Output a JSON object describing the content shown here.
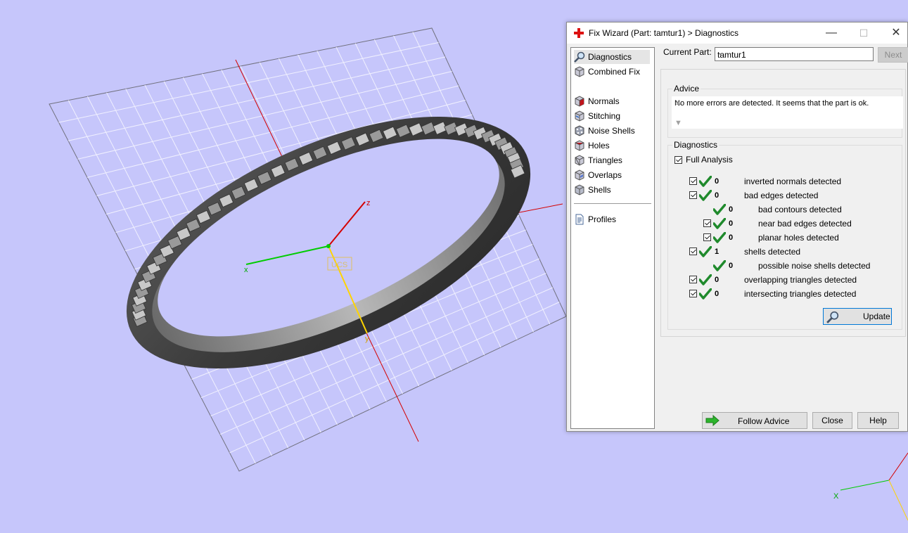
{
  "window": {
    "title": "Fix Wizard (Part: tamtur1) > Diagnostics",
    "minimize": "—",
    "maximize": "☐",
    "close": "✕"
  },
  "nav": {
    "items": [
      {
        "label": "Diagnostics",
        "icon": "magnifier-icon",
        "selected": true
      },
      {
        "label": "Combined Fix",
        "icon": "cube-icon"
      },
      {
        "label": "Normals",
        "icon": "normals-cube-icon"
      },
      {
        "label": "Stitching",
        "icon": "stitching-cube-icon"
      },
      {
        "label": "Noise Shells",
        "icon": "noise-shells-icon"
      },
      {
        "label": "Holes",
        "icon": "holes-cube-icon"
      },
      {
        "label": "Triangles",
        "icon": "triangles-cube-icon"
      },
      {
        "label": "Overlaps",
        "icon": "overlaps-cube-icon"
      },
      {
        "label": "Shells",
        "icon": "shells-cube-icon"
      },
      {
        "label": "Profiles",
        "icon": "document-icon"
      }
    ]
  },
  "current_part": {
    "label": "Current Part:",
    "value": "tamtur1",
    "next_label": "Next"
  },
  "advice": {
    "title": "Advice",
    "text": "No more errors are detected. It seems that the part is ok."
  },
  "diagnostics": {
    "title": "Diagnostics",
    "full_analysis_label": "Full Analysis",
    "rows": [
      {
        "count": "0",
        "label": "inverted normals detected",
        "checked": true
      },
      {
        "count": "0",
        "label": "bad edges detected",
        "checked": true
      },
      {
        "count": "0",
        "label": "bad contours detected",
        "checked": false
      },
      {
        "count": "0",
        "label": "near bad edges detected",
        "checked": true
      },
      {
        "count": "0",
        "label": "planar holes detected",
        "checked": true
      },
      {
        "count": "1",
        "label": "shells detected",
        "checked": true
      },
      {
        "count": "0",
        "label": "possible noise shells detected",
        "checked": false
      },
      {
        "count": "0",
        "label": "overlapping triangles detected",
        "checked": true
      },
      {
        "count": "0",
        "label": "intersecting triangles detected",
        "checked": true
      }
    ],
    "update_label": "Update"
  },
  "footer": {
    "follow_advice_label": "Follow Advice",
    "close_label": "Close",
    "help_label": "Help"
  },
  "viewport": {
    "x_axis_label": "x",
    "y_axis_label": "y",
    "z_axis_label": "z",
    "ucs_label": "UCS",
    "corner_x_label": "X"
  },
  "colors": {
    "background": "#c6c6fb",
    "x_axis": "#00cc00",
    "y_axis": "#ffd400",
    "z_axis": "#d40000",
    "check_green": "#1f8a2c"
  }
}
